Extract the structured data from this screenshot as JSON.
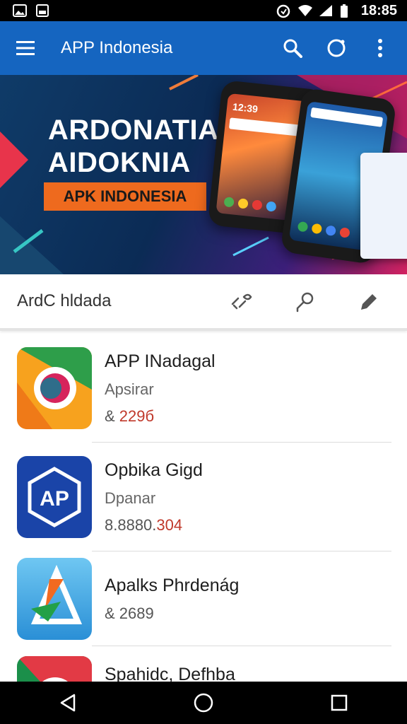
{
  "status_bar": {
    "time": "18:85",
    "icons": [
      "gallery-icon",
      "image-icon",
      "data-saver-icon",
      "wifi-icon",
      "signal-icon",
      "battery-icon"
    ]
  },
  "app_bar": {
    "title": "APP Indonesia",
    "color": "#1565c0",
    "actions": [
      "search-icon",
      "circle-icon",
      "more-vert-icon"
    ]
  },
  "banner": {
    "line1": "ARDONATIA",
    "line2": "AIDOKNIA",
    "tag": "APK INDONESIA",
    "phone_clock": "12:39"
  },
  "toolbar": {
    "label": "ArdC hldada",
    "actions": [
      "wrench-link-icon",
      "key-icon",
      "pen-icon"
    ]
  },
  "apps": [
    {
      "name": "APP INadagal",
      "developer": "Apsirar",
      "price_prefix": "& ",
      "price_value": "229б"
    },
    {
      "name": "Opbika Gigd",
      "developer": "Dpanar",
      "price_prefix": "8.8880.",
      "price_value": "304"
    },
    {
      "name": "Apalks Phrdenág",
      "developer": "",
      "price_prefix": "& 2689",
      "price_value": ""
    },
    {
      "name": "Spahidc, Defhba",
      "developer": "",
      "price_prefix": "",
      "price_value": ""
    }
  ],
  "nav_bar": [
    "back-icon",
    "home-icon",
    "recents-icon"
  ]
}
